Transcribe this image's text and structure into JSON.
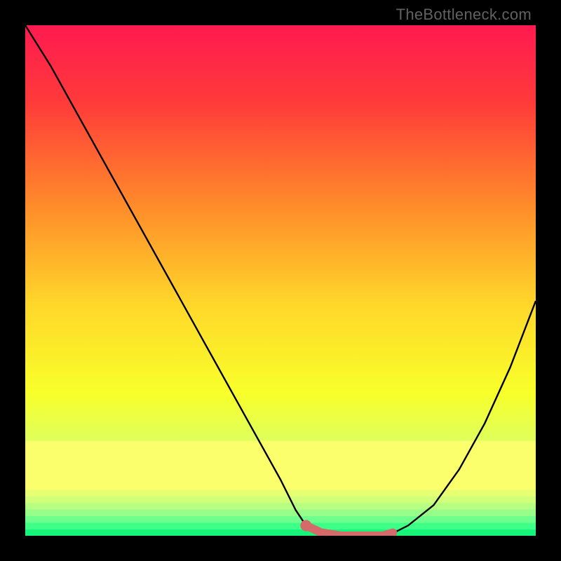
{
  "watermark": "TheBottleneck.com",
  "chart_data": {
    "type": "line",
    "title": "",
    "xlabel": "",
    "ylabel": "",
    "xlim": [
      0,
      100
    ],
    "ylim": [
      0,
      100
    ],
    "grid": false,
    "legend": false,
    "gradient_stops": [
      {
        "offset": 0,
        "color": "#ff1a50"
      },
      {
        "offset": 15,
        "color": "#ff3a3a"
      },
      {
        "offset": 35,
        "color": "#ff8a2a"
      },
      {
        "offset": 55,
        "color": "#ffd82a"
      },
      {
        "offset": 72,
        "color": "#f8ff2a"
      },
      {
        "offset": 84,
        "color": "#d8ff6a"
      },
      {
        "offset": 92,
        "color": "#a0ff8a"
      },
      {
        "offset": 100,
        "color": "#20ff80"
      }
    ],
    "series": [
      {
        "name": "bottleneck-curve",
        "type": "line",
        "x": [
          0,
          5,
          10,
          15,
          20,
          25,
          30,
          35,
          40,
          45,
          50,
          53,
          55,
          58,
          62,
          66,
          70,
          72,
          75,
          80,
          85,
          90,
          95,
          100
        ],
        "y": [
          100,
          92,
          83,
          74,
          65,
          56,
          47,
          38,
          29,
          20,
          11,
          5,
          2,
          0.5,
          0,
          0,
          0,
          0.5,
          2,
          6,
          13,
          22,
          33,
          46
        ]
      },
      {
        "name": "optimal-marker",
        "type": "marker",
        "x": [
          55,
          58,
          62,
          66,
          70,
          72
        ],
        "y": [
          2,
          0.6,
          0,
          0,
          0,
          0.6
        ],
        "color": "#d46a6a"
      }
    ],
    "bottom_bands": [
      {
        "height_pct": 9.5,
        "color": "#fbff6b"
      },
      {
        "height_pct": 1.3,
        "color": "#e9ff73"
      },
      {
        "height_pct": 1.3,
        "color": "#d2ff7a"
      },
      {
        "height_pct": 1.3,
        "color": "#b7ff82"
      },
      {
        "height_pct": 1.3,
        "color": "#97ff89"
      },
      {
        "height_pct": 1.3,
        "color": "#6fff8d"
      },
      {
        "height_pct": 1.3,
        "color": "#3eff87"
      },
      {
        "height_pct": 1.3,
        "color": "#16f57a"
      }
    ]
  }
}
